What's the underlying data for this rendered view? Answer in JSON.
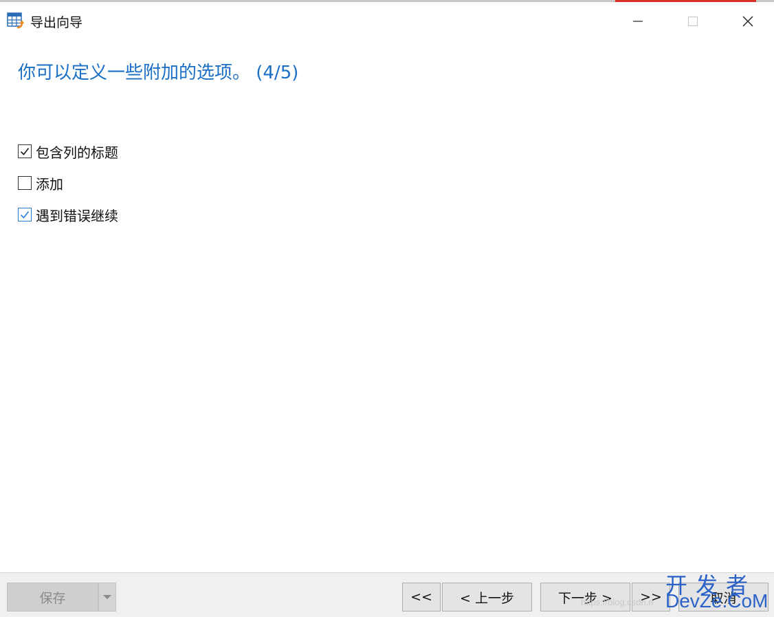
{
  "window": {
    "title": "导出向导",
    "icon": "table-export-icon"
  },
  "heading": "你可以定义一些附加的选项。 (4/5)",
  "options": [
    {
      "label": "包含列的标题",
      "checked": true
    },
    {
      "label": "添加",
      "checked": false
    },
    {
      "label": "遇到错误继续",
      "checked": true
    }
  ],
  "footer": {
    "save_label": "保存",
    "first_label": "<<",
    "prev_label": "< 上一步",
    "next_label": "下一步 >",
    "last_label": ">>",
    "cancel_label": "取消"
  },
  "watermark": {
    "url": "https://blog.csdn.n",
    "brand_cn": "开发者",
    "brand_en": "DevZe.CoM"
  },
  "colors": {
    "heading": "#1a6fc4",
    "checkbox_accent": "#2a7fd4",
    "watermark": "#2b62c9"
  }
}
